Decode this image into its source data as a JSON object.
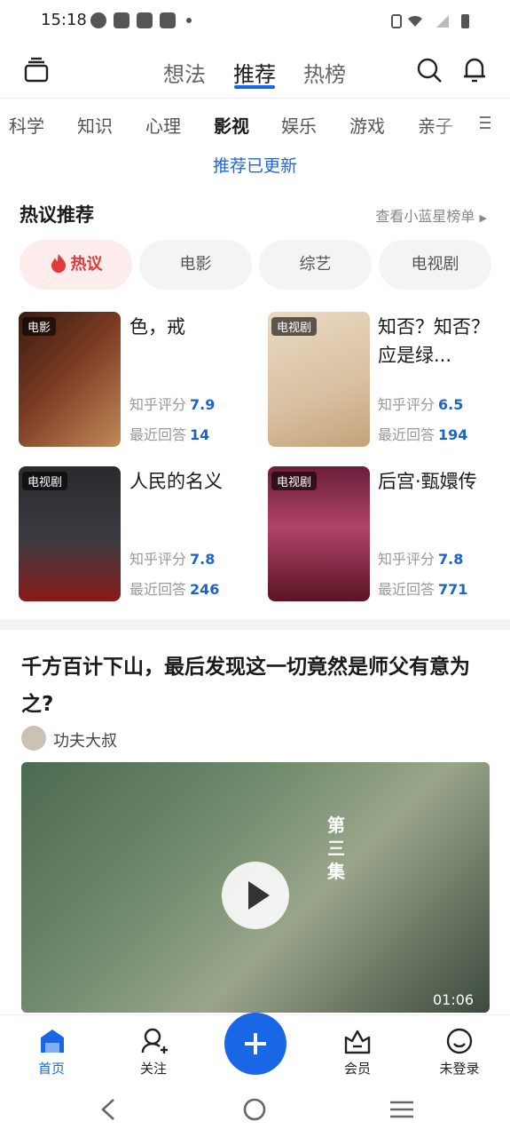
{
  "status": {
    "time": "15:18"
  },
  "header": {
    "tabs": [
      {
        "label": "想法"
      },
      {
        "label": "推荐"
      },
      {
        "label": "热榜"
      }
    ]
  },
  "categories": [
    "科学",
    "知识",
    "心理",
    "影视",
    "娱乐",
    "游戏",
    "亲子"
  ],
  "update_notice": "推荐已更新",
  "hot": {
    "title": "热议推荐",
    "link": "查看小蓝星榜单",
    "filters": [
      "热议",
      "电影",
      "综艺",
      "电视剧"
    ],
    "cards": [
      {
        "tag": "电影",
        "title": "色，戒",
        "rating_label": "知乎评分",
        "rating": "7.9",
        "answers_label": "最近回答",
        "answers": "14"
      },
      {
        "tag": "电视剧",
        "title": "知否？知否？应是绿...",
        "rating_label": "知乎评分",
        "rating": "6.5",
        "answers_label": "最近回答",
        "answers": "194"
      },
      {
        "tag": "电视剧",
        "title": "人民的名义",
        "rating_label": "知乎评分",
        "rating": "7.8",
        "answers_label": "最近回答",
        "answers": "246"
      },
      {
        "tag": "电视剧",
        "title": "后宫·甄嬛传",
        "rating_label": "知乎评分",
        "rating": "7.8",
        "answers_label": "最近回答",
        "answers": "771"
      }
    ]
  },
  "feed": {
    "title": "千方百计下山，最后发现这一切竟然是师父有意为之?",
    "author": "功夫大叔",
    "video": {
      "duration": "01:06",
      "overlay_text": "第三集"
    }
  },
  "bottom_nav": [
    {
      "label": "首页"
    },
    {
      "label": "关注"
    },
    {
      "label": "会员"
    },
    {
      "label": "未登录"
    }
  ],
  "colors": {
    "accent": "#1967e6",
    "hot_red": "#e03b3b"
  }
}
